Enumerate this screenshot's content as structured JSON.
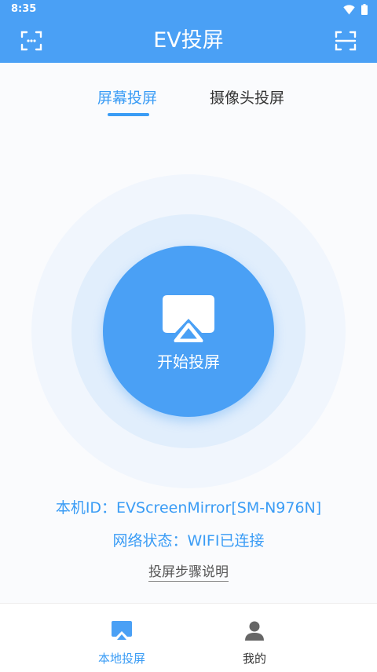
{
  "status_bar": {
    "time": "8:35"
  },
  "app_bar": {
    "title": "EV投屏"
  },
  "tabs": [
    {
      "label": "屏幕投屏",
      "active": true
    },
    {
      "label": "摄像头投屏",
      "active": false
    }
  ],
  "cast_button": {
    "label": "开始投屏",
    "icon": "airplay-icon"
  },
  "info": {
    "device_id": "本机ID：EVScreenMirror[SM-N976N]",
    "network_status": "网络状态：WIFI已连接",
    "instructions_link": "投屏步骤说明"
  },
  "bottom_nav": [
    {
      "label": "本地投屏",
      "icon": "screen-cast-icon",
      "active": true
    },
    {
      "label": "我的",
      "icon": "person-icon",
      "active": false
    }
  ],
  "colors": {
    "primary": "#4aa0f5",
    "accent_text": "#3a9cf5",
    "ring_outer": "#f1f6fd",
    "ring_inner": "#e1eefc"
  }
}
